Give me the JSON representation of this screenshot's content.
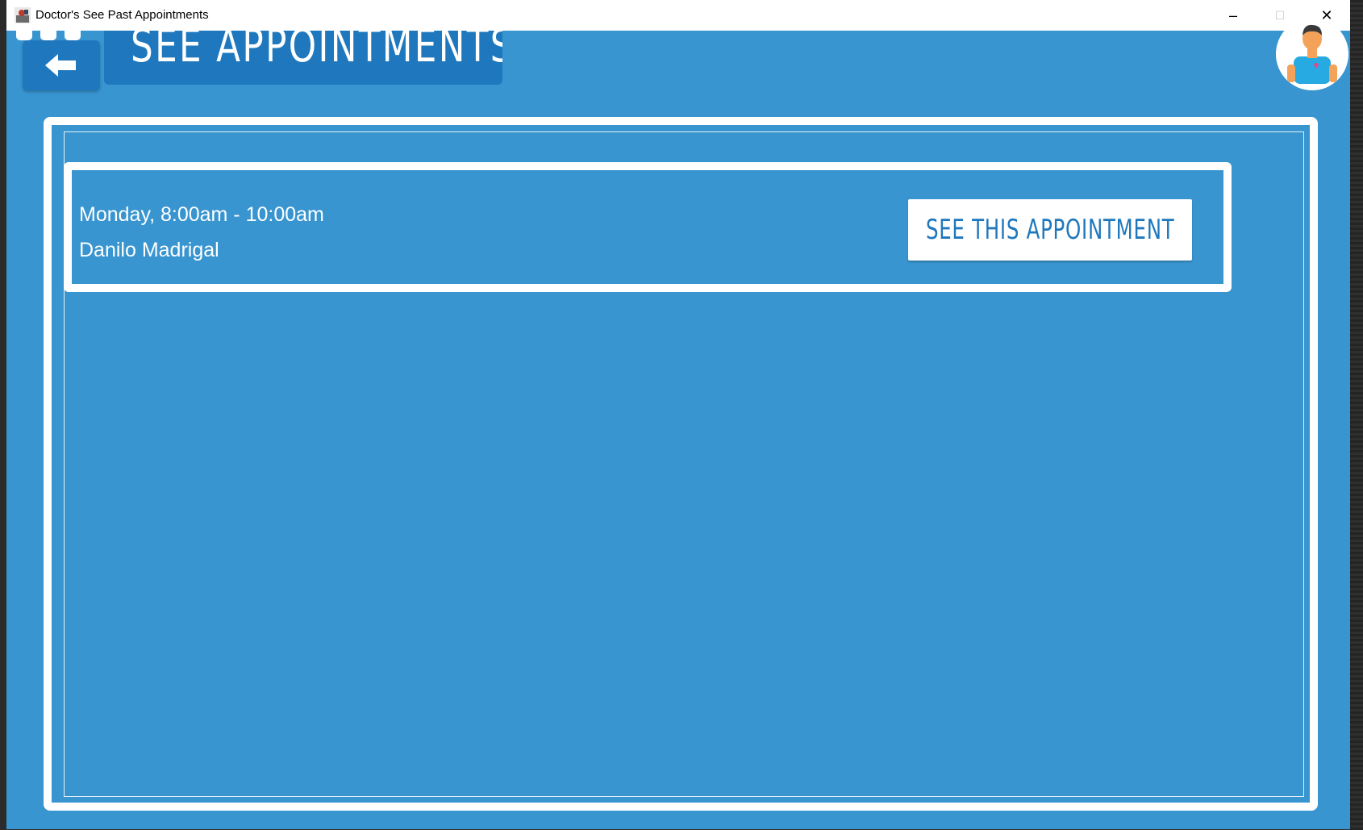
{
  "window": {
    "title": "Doctor's See Past Appointments",
    "controls": {
      "minimize": "–",
      "maximize": "☐",
      "close": "✕"
    }
  },
  "header": {
    "title": "SEE APPOINTMENTS",
    "back_icon": "arrow-left-icon",
    "avatar_icon": "doctor-avatar-icon"
  },
  "appointments": [
    {
      "time": "Monday, 8:00am - 10:00am",
      "patient": "Danilo Madrigal",
      "button_label": "SEE THIS APPOINTMENT"
    }
  ],
  "colors": {
    "background": "#3895d0",
    "header_box": "#1f78bd",
    "panel_border": "#ffffff",
    "button_text": "#1f78bd"
  }
}
